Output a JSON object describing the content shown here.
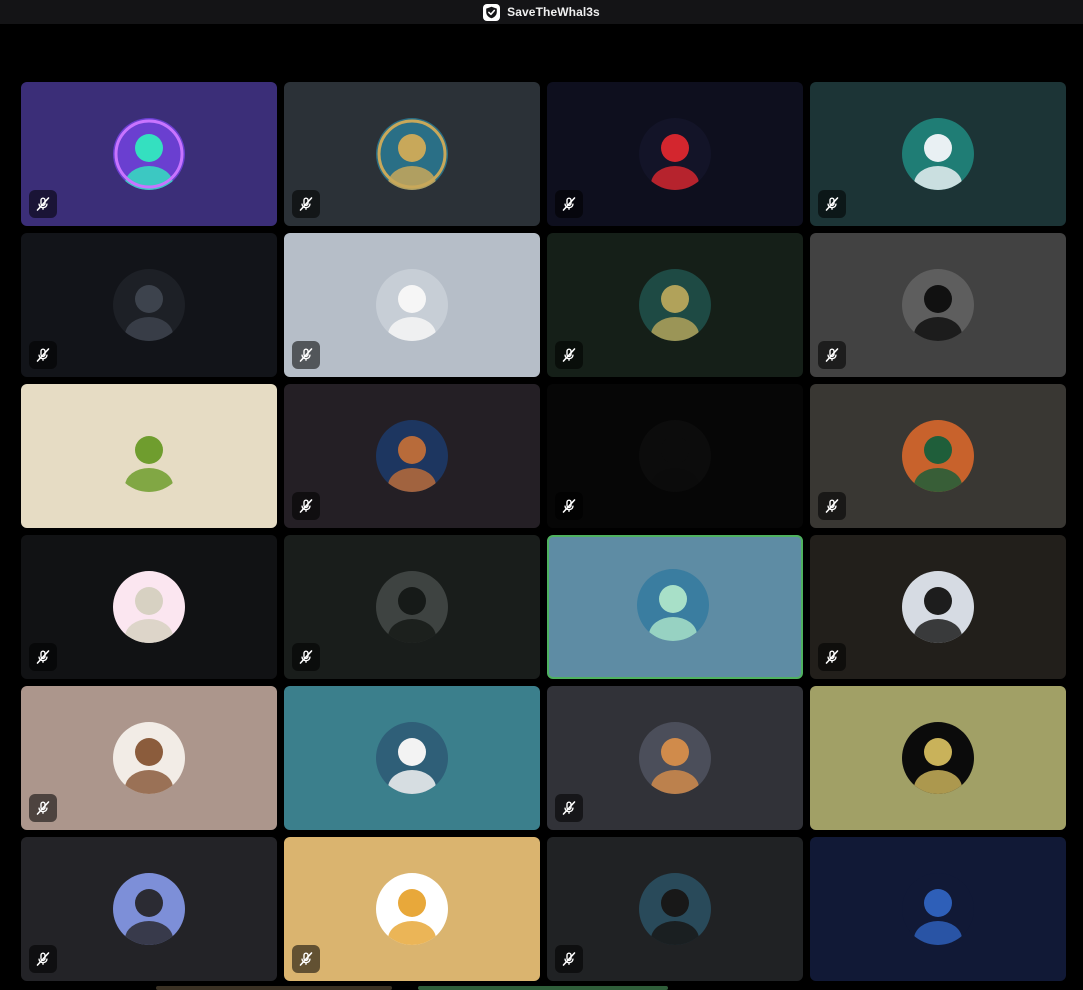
{
  "window": {
    "title": "SaveTheWhal3s",
    "app_icon": "shield-check-icon"
  },
  "colors": {
    "active_border": "#4fb260",
    "titlebar": "#141416"
  },
  "participants": [
    {
      "bg": "#3b2e78",
      "muted": true,
      "avatar": {
        "bg": "#6a3fd0",
        "accent": "#34e0c0",
        "ring": "#c874ff"
      }
    },
    {
      "bg": "#2b3137",
      "muted": true,
      "avatar": {
        "bg": "#2a6f86",
        "accent": "#c8a85a",
        "ring": "#c8a85a"
      }
    },
    {
      "bg": "#0e0f1e",
      "muted": true,
      "avatar": {
        "bg": "#131428",
        "accent": "#d3262e"
      }
    },
    {
      "bg": "#1c3436",
      "muted": true,
      "avatar": {
        "bg": "#1f7d75",
        "accent": "#e9f0f3"
      }
    },
    {
      "bg": "#121419",
      "muted": true,
      "avatar": {
        "bg": "#1d2026",
        "accent": "#3d434d"
      }
    },
    {
      "bg": "#b6bec8",
      "muted": true,
      "avatar": {
        "bg": "#c7ced6",
        "accent": "#f6f6f6"
      }
    },
    {
      "bg": "#151f18",
      "muted": true,
      "avatar": {
        "bg": "#1e4a44",
        "accent": "#b1a25a"
      }
    },
    {
      "bg": "#424242",
      "muted": true,
      "avatar": {
        "bg": "#5e5e5e",
        "accent": "#111111"
      }
    },
    {
      "bg": "#e6dcc4",
      "muted": false,
      "avatar": {
        "bg": "#e6dcc4",
        "accent": "#6f9d2e"
      }
    },
    {
      "bg": "#241f25",
      "muted": true,
      "avatar": {
        "bg": "#1d3660",
        "accent": "#b86b3a"
      }
    },
    {
      "bg": "#060606",
      "muted": true,
      "avatar": {
        "bg": "#0c0c0c",
        "accent": "#0c0c0c"
      }
    },
    {
      "bg": "#393733",
      "muted": true,
      "avatar": {
        "bg": "#c8622c",
        "accent": "#1f5e3a"
      }
    },
    {
      "bg": "#111214",
      "muted": true,
      "avatar": {
        "bg": "#fbe6f0",
        "accent": "#d7d1c2"
      }
    },
    {
      "bg": "#191d1b",
      "muted": true,
      "avatar": {
        "bg": "#3e4341",
        "accent": "#161a18"
      }
    },
    {
      "bg": "#5e8ca4",
      "muted": false,
      "active": true,
      "avatar": {
        "bg": "#3a7da0",
        "accent": "#a8e0c8"
      }
    },
    {
      "bg": "#221f1b",
      "muted": true,
      "avatar": {
        "bg": "#d6dbe3",
        "accent": "#1d1d1d"
      }
    },
    {
      "bg": "#ac968c",
      "muted": true,
      "avatar": {
        "bg": "#f2ece6",
        "accent": "#8b5c3c"
      }
    },
    {
      "bg": "#3b7f8c",
      "muted": false,
      "avatar": {
        "bg": "#2f5f78",
        "accent": "#f3f3f3"
      }
    },
    {
      "bg": "#313238",
      "muted": true,
      "avatar": {
        "bg": "#4b4e5a",
        "accent": "#d08b4b"
      }
    },
    {
      "bg": "#a1a066",
      "muted": false,
      "avatar": {
        "bg": "#0b0b0b",
        "accent": "#c9b25a"
      }
    },
    {
      "bg": "#232327",
      "muted": true,
      "avatar": {
        "bg": "#7d8fd8",
        "accent": "#2b2b33"
      }
    },
    {
      "bg": "#dab46f",
      "muted": true,
      "avatar": {
        "bg": "#ffffff",
        "accent": "#e8a83a"
      }
    },
    {
      "bg": "#202224",
      "muted": true,
      "avatar": {
        "bg": "#294a5a",
        "accent": "#181818"
      }
    },
    {
      "bg": "#111936",
      "muted": false,
      "avatar": {
        "bg": "#111936",
        "accent": "#2e5fb8"
      }
    }
  ]
}
